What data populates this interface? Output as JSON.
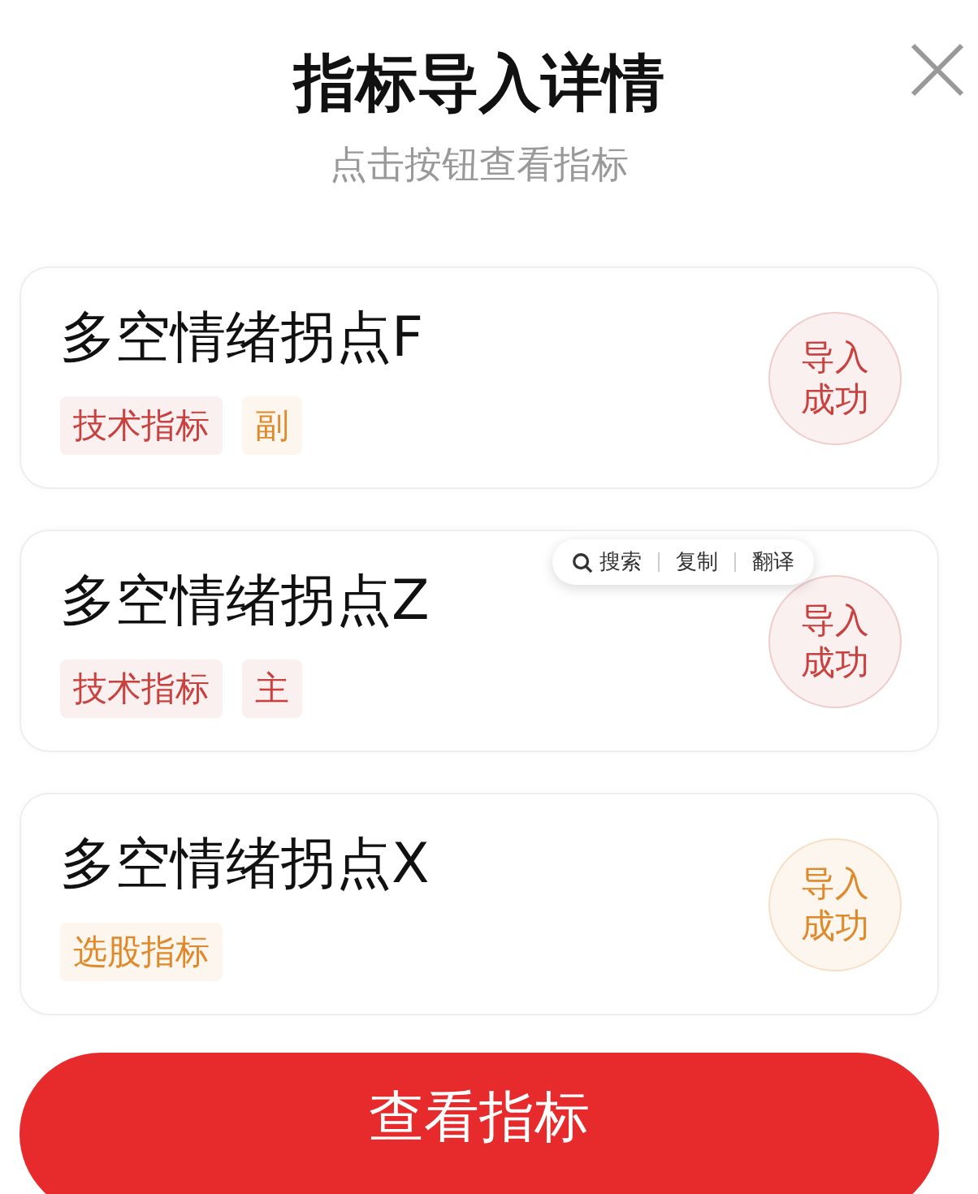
{
  "title": "指标导入详情",
  "subtitle": "点击按钮查看指标",
  "items": [
    {
      "name": "多空情绪拐点F",
      "tags": [
        {
          "label": "技术指标",
          "color": "#c9413f"
        },
        {
          "label": "副",
          "color": "#e0892a"
        }
      ],
      "status": {
        "label": "导入成功",
        "color": "#c9413f"
      }
    },
    {
      "name": "多空情绪拐点Z",
      "tags": [
        {
          "label": "技术指标",
          "color": "#c9413f"
        },
        {
          "label": "主",
          "color": "#c9413f"
        }
      ],
      "status": {
        "label": "导入成功",
        "color": "#c9413f"
      },
      "popup": {
        "actions": [
          "搜索",
          "复制",
          "翻译"
        ]
      }
    },
    {
      "name": "多空情绪拐点X",
      "tags": [
        {
          "label": "选股指标",
          "color": "#e0892a"
        }
      ],
      "status": {
        "label": "导入成功",
        "color": "#e0892a"
      }
    }
  ],
  "button": "查看指标"
}
